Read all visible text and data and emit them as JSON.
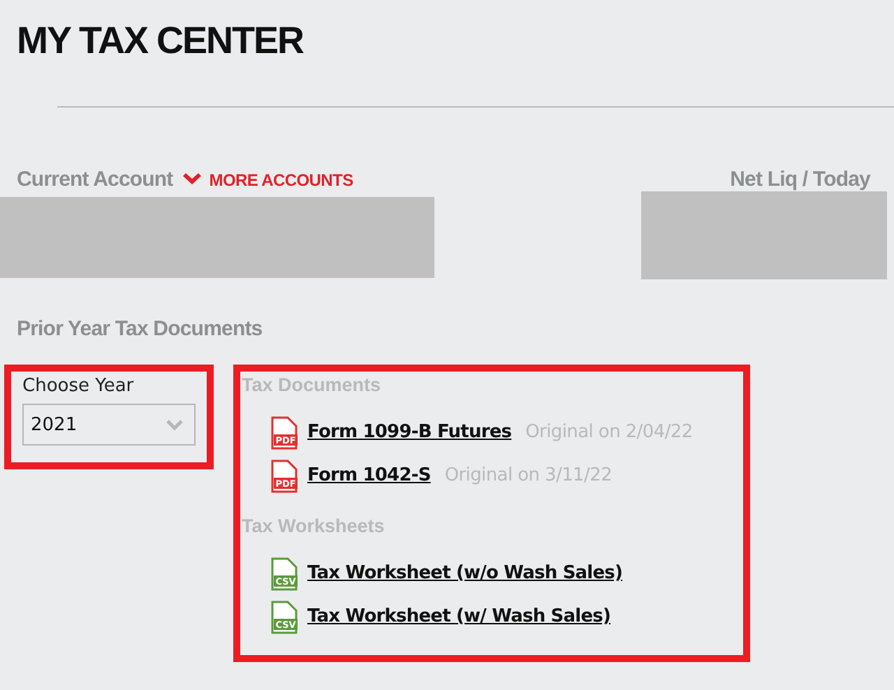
{
  "page": {
    "title": "MY TAX CENTER"
  },
  "account": {
    "label": "Current Account",
    "more_link": "MORE ACCOUNTS",
    "right_label": "Net Liq / Today"
  },
  "section_title": "Prior Year Tax Documents",
  "year": {
    "label": "Choose Year",
    "value": "2021"
  },
  "groups": [
    {
      "title": "Tax Documents",
      "items": [
        {
          "kind": "pdf",
          "icon_text": "PDF",
          "name": "Form 1099-B Futures",
          "note": "Original on 2/04/22"
        },
        {
          "kind": "pdf",
          "icon_text": "PDF",
          "name": "Form 1042-S",
          "note": "Original on 3/11/22"
        }
      ]
    },
    {
      "title": "Tax Worksheets",
      "items": [
        {
          "kind": "csv",
          "icon_text": "CSV",
          "name": "Tax Worksheet (w/o Wash Sales)"
        },
        {
          "kind": "csv",
          "icon_text": "CSV",
          "name": "Tax Worksheet (w/ Wash Sales)"
        }
      ]
    }
  ]
}
